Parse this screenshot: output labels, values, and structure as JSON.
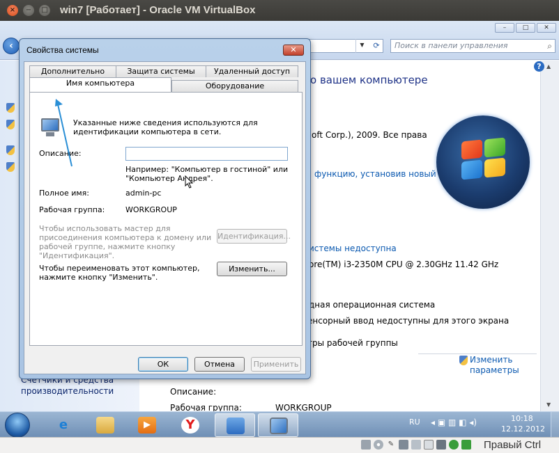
{
  "host_window": {
    "title": "win7 [Работает] - Oracle VM VirtualBox",
    "close_glyph": "×",
    "min_glyph": "−",
    "max_glyph": "□"
  },
  "control_panel": {
    "search_placeholder": "Поиск в панели управления",
    "heading": "о вашем компьютере",
    "copyright": "oft Corp.), 2009. Все права",
    "more_features_link": "функцию, установив новый",
    "rating_link": "истемы недоступна",
    "processor": "ore(TM) i3-2350M CPU @ 2.30GHz   11.42 GHz",
    "os_type": "дная операционная система",
    "pen_touch": "енсорный ввод недоступны для этого экрана",
    "workgroup_section": "тры рабочей группы",
    "change_settings_link": "Изменить\nпараметры",
    "left_bottom_link": "Счетчики и средства\nпроизводительности",
    "desc_label": "Описание:",
    "workgroup_label": "Рабочая группа:",
    "workgroup_value": "WORKGROUP"
  },
  "dialog": {
    "title": "Свойства системы",
    "close_glyph": "✕",
    "tabs_back": [
      "Дополнительно",
      "Защита системы",
      "Удаленный доступ"
    ],
    "tabs_front": [
      "Имя компьютера",
      "Оборудование"
    ],
    "active_tab": "Имя компьютера",
    "intro": "Указанные ниже сведения используются для\nидентификации компьютера в сети.",
    "description_label": "Описание:",
    "description_value": "",
    "example": "Например: \"Компьютер в гостиной\" или\n\"Компьютер Андрея\".",
    "full_name_label": "Полное имя:",
    "full_name_value": "admin-pc",
    "workgroup_label": "Рабочая группа:",
    "workgroup_value": "WORKGROUP",
    "wizard_text": "Чтобы использовать мастер для\nприсоединения компьютера к домену или\nрабочей группе, нажмите кнопку\n\"Идентификация\".",
    "identify_button": "Идентификация...",
    "rename_text": "Чтобы переименовать этот компьютер,\nнажмите кнопку \"Изменить\".",
    "change_button": "Изменить...",
    "ok_button": "ОК",
    "cancel_button": "Отмена",
    "apply_button": "Применить"
  },
  "taskbar": {
    "language": "RU",
    "time": "10:18",
    "date": "12.12.2012",
    "apps": [
      "internet-explorer",
      "file-explorer",
      "media-player",
      "yandex",
      "control-panel",
      "system-properties"
    ]
  },
  "vbox_status": {
    "host_key": "Правый Ctrl"
  },
  "colors": {
    "link": "#0b59b0",
    "heading": "#1e3287",
    "annotation_arrow": "#2b8fd6"
  }
}
